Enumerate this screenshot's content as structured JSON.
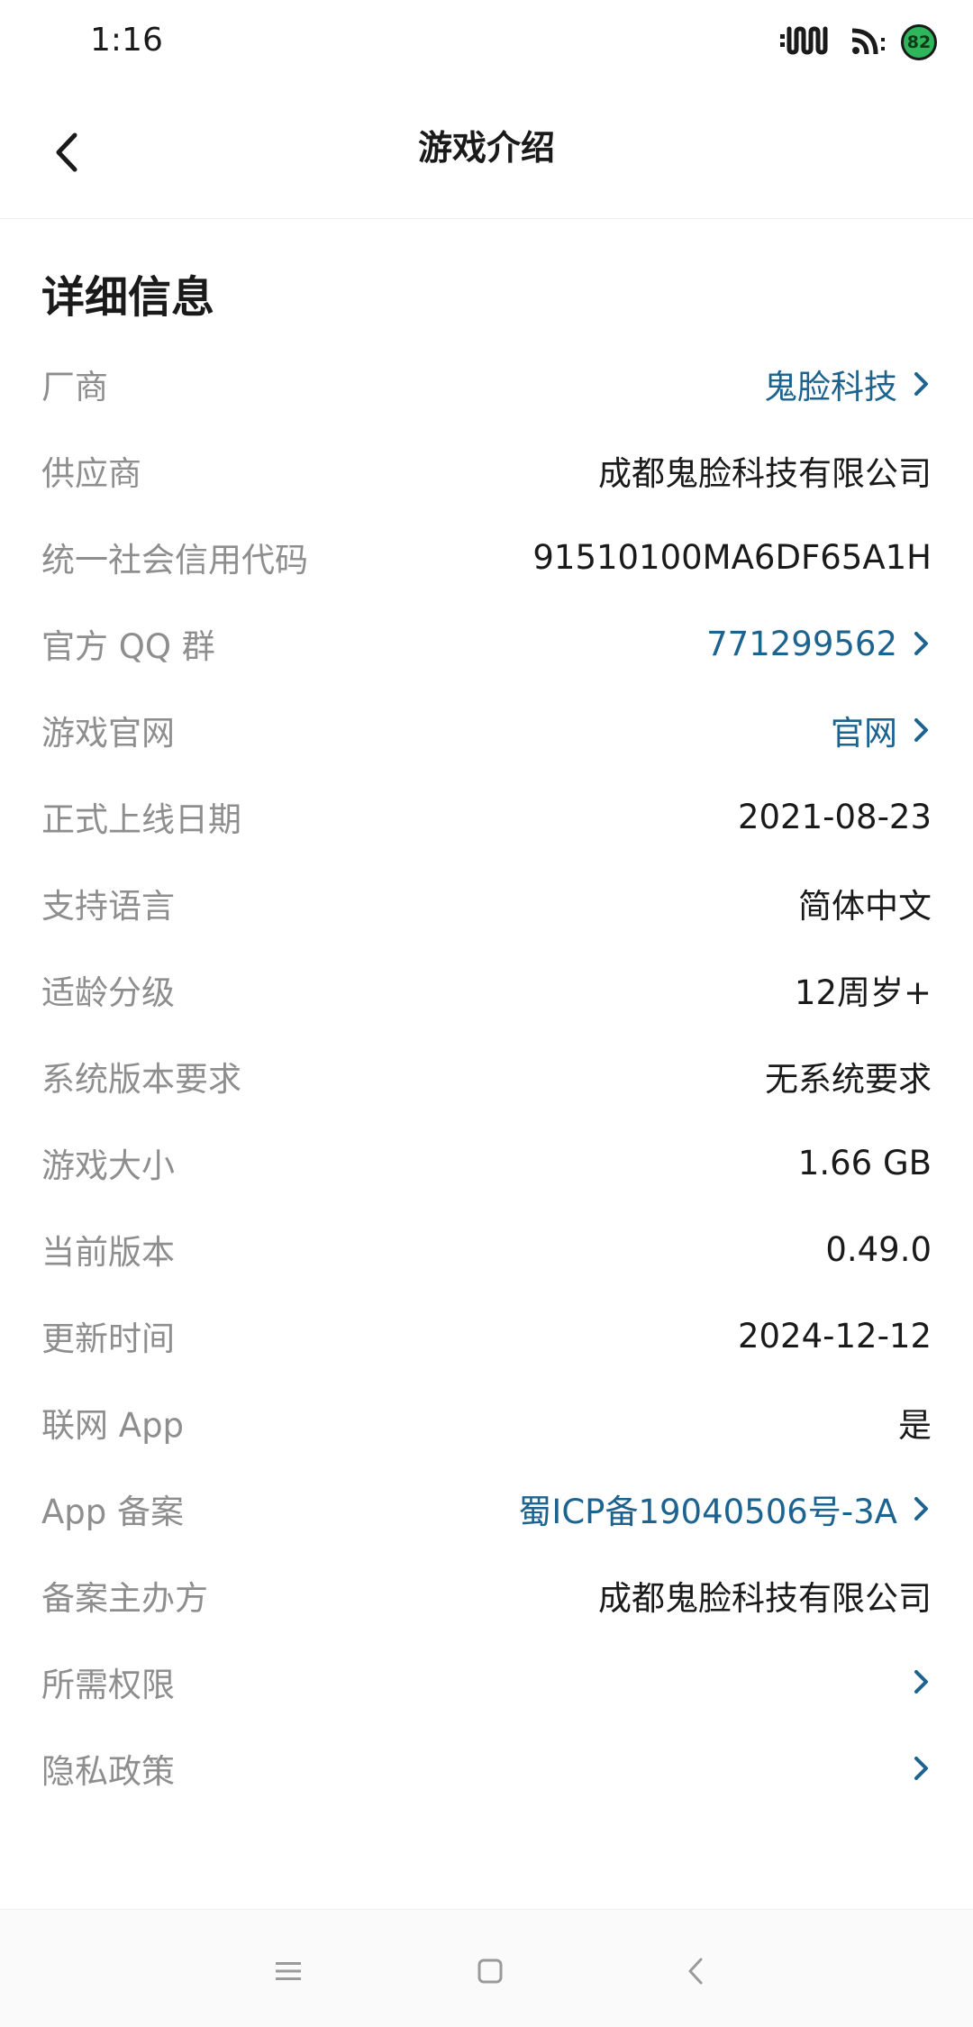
{
  "status_bar": {
    "time": "1:16",
    "battery": "82",
    "icons": [
      "signal-bars-icon",
      "wifi-icon",
      "battery-icon"
    ]
  },
  "header": {
    "title": "游戏介绍",
    "back_icon": "chevron-left-icon"
  },
  "section": {
    "title": "详细信息"
  },
  "rows": [
    {
      "label": "厂商",
      "value": "鬼脸科技",
      "link": true
    },
    {
      "label": "供应商",
      "value": "成都鬼脸科技有限公司",
      "link": false
    },
    {
      "label": "统一社会信用代码",
      "value": "91510100MA6DF65A1H",
      "link": false
    },
    {
      "label": "官方 QQ 群",
      "value": "771299562",
      "link": true
    },
    {
      "label": "游戏官网",
      "value": "官网",
      "link": true
    },
    {
      "label": "正式上线日期",
      "value": "2021-08-23",
      "link": false
    },
    {
      "label": "支持语言",
      "value": "简体中文",
      "link": false
    },
    {
      "label": "适龄分级",
      "value": "12周岁+",
      "link": false
    },
    {
      "label": "系统版本要求",
      "value": "无系统要求",
      "link": false
    },
    {
      "label": "游戏大小",
      "value": "1.66 GB",
      "link": false
    },
    {
      "label": "当前版本",
      "value": "0.49.0",
      "link": false
    },
    {
      "label": "更新时间",
      "value": "2024-12-12",
      "link": false
    },
    {
      "label": "联网 App",
      "value": "是",
      "link": false
    },
    {
      "label": "App 备案",
      "value": "蜀ICP备19040506号-3A",
      "link": true
    },
    {
      "label": "备案主办方",
      "value": "成都鬼脸科技有限公司",
      "link": false
    },
    {
      "label": "所需权限",
      "value": "",
      "link": true
    },
    {
      "label": "隐私政策",
      "value": "",
      "link": true
    }
  ],
  "colors": {
    "link": "#1d6390",
    "label": "#8e8e8e",
    "value": "#1a1a1a",
    "battery": "#2fb65b"
  },
  "nav_bar": {
    "icons": [
      "menu-icon",
      "home-square-icon",
      "back-triangle-icon"
    ]
  }
}
